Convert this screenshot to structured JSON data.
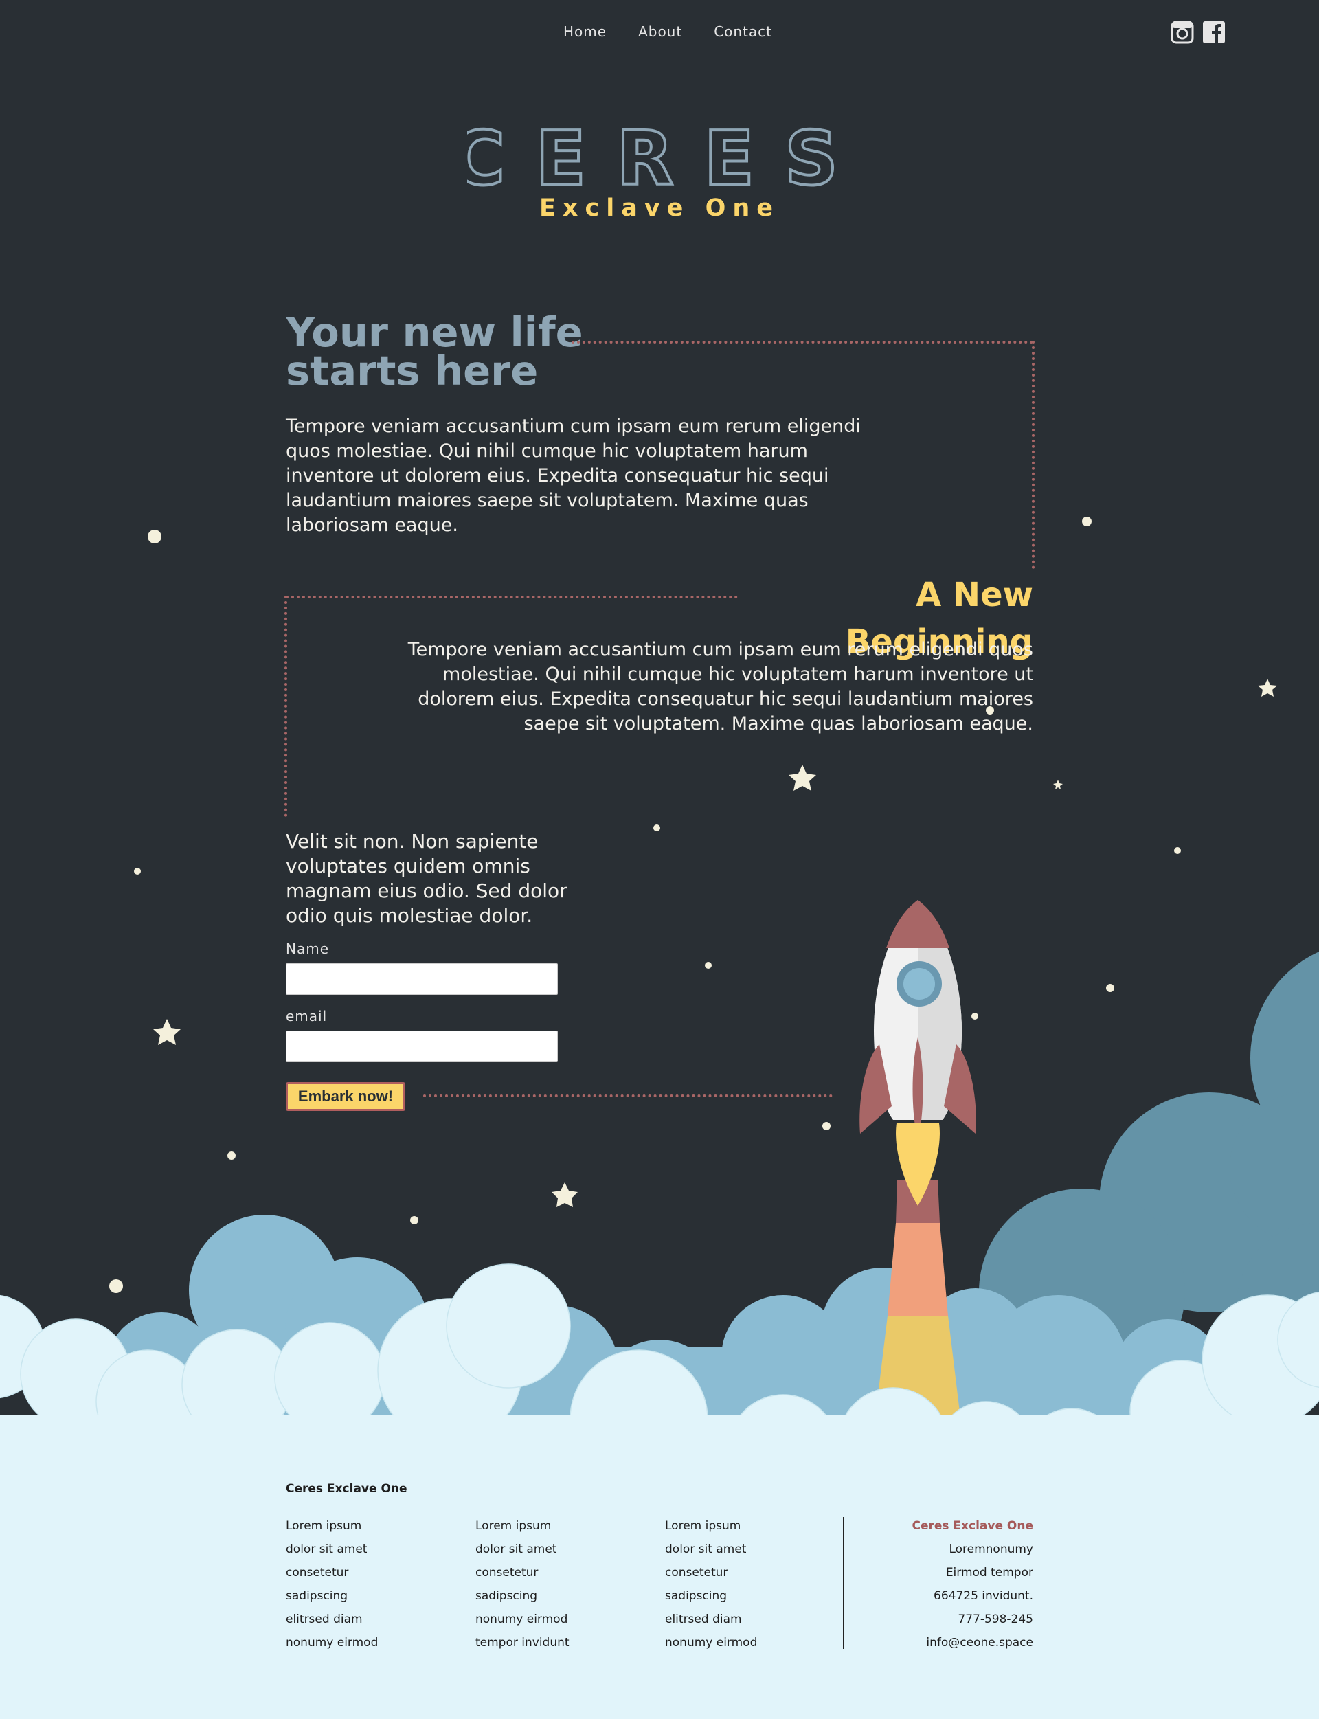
{
  "nav": {
    "items": [
      {
        "label": "Home"
      },
      {
        "label": "About"
      },
      {
        "label": "Contact"
      }
    ]
  },
  "social": {
    "icons": [
      "instagram-icon",
      "facebook-icon"
    ]
  },
  "brand": {
    "title": "CERES",
    "subtitle": "Exclave One"
  },
  "intro": {
    "heading": "Your new life starts here",
    "body": "Tempore veniam accusantium cum ipsam eum rerum eligendi quos molestiae. Qui nihil cumque hic voluptatem harum inventore ut dolorem eius. Expedita consequatur hic sequi laudantium maiores saepe sit voluptatem. Maxime quas laboriosam eaque."
  },
  "beginning": {
    "heading": "A New Beginning",
    "body": "Tempore veniam accusantium cum ipsam eum rerum eligendi quos molestiae. Qui nihil cumque hic voluptatem harum inventore ut dolorem eius. Expedita consequatur hic sequi laudantium maiores saepe sit voluptatem. Maxime quas laboriosam eaque."
  },
  "signup": {
    "text": "Velit sit non. Non sapiente voluptates quidem omnis magnam eius odio. Sed dolor odio quis molestiae dolor.",
    "name_label": "Name",
    "name_value": "",
    "email_label": "email",
    "email_value": "",
    "button_label": "Embark now!"
  },
  "footer": {
    "title": "Ceres Exclave One",
    "columns": [
      [
        "Lorem ipsum",
        "dolor sit amet",
        "consetetur",
        "sadipscing",
        "elitrsed diam",
        "nonumy eirmod"
      ],
      [
        "Lorem ipsum",
        "dolor sit amet",
        "consetetur",
        "sadipscing",
        "nonumy eirmod",
        "tempor invidunt"
      ],
      [
        "Lorem ipsum",
        "dolor sit amet",
        "consetetur",
        "sadipscing",
        "elitrsed diam",
        "nonumy eirmod"
      ]
    ],
    "contact": [
      "Ceres Exclave One",
      "Loremnonumy",
      "Eirmod tempor",
      "664725 invidunt.",
      "777-598-245",
      "info@ceone.space"
    ]
  },
  "colors": {
    "background": "#292f34",
    "accent_yellow": "#fbd56a",
    "accent_red": "#a86666",
    "heading_blue": "#8ea5b4",
    "cloud_dark": "#6493a7",
    "cloud_mid": "#8bbcd3",
    "cloud_light": "#e1f4fa"
  }
}
